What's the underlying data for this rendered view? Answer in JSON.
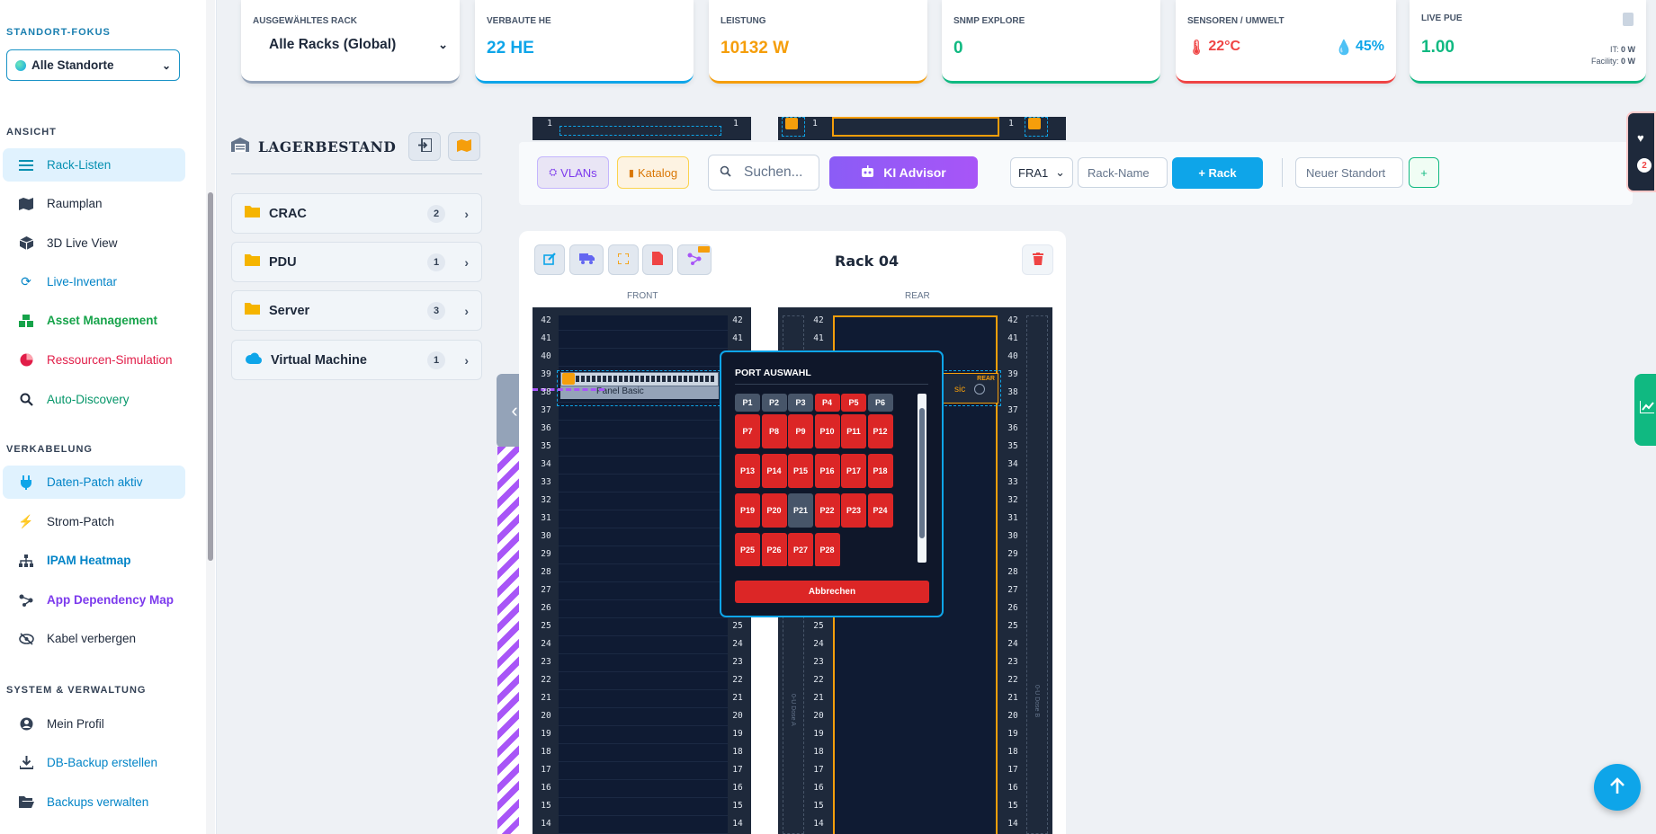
{
  "sidebar": {
    "site_section": "STANDORT-FOKUS",
    "site_select": "Alle Standorte",
    "section_view": "ANSICHT",
    "view_items": [
      {
        "label": "Rack-Listen",
        "color": "#0891b2"
      },
      {
        "label": "Raumplan",
        "color": "#1e293b"
      },
      {
        "label": "3D Live View",
        "color": "#1e293b"
      },
      {
        "label": "Live-Inventar",
        "color": "#0284c7"
      },
      {
        "label": "Asset Management",
        "color": "#16a34a"
      },
      {
        "label": "Ressourcen-Simulation",
        "color": "#e11d48"
      },
      {
        "label": "Auto-Discovery",
        "color": "#059669"
      }
    ],
    "section_cabling": "VERKABELUNG",
    "cabling_items": [
      {
        "label": "Daten-Patch aktiv",
        "color": "#0284c7"
      },
      {
        "label": "Strom-Patch",
        "color": "#1e293b"
      },
      {
        "label": "IPAM Heatmap",
        "color": "#0284c7"
      },
      {
        "label": "App Dependency Map",
        "color": "#7c3aed"
      },
      {
        "label": "Kabel verbergen",
        "color": "#1e293b"
      }
    ],
    "section_system": "SYSTEM & VERWALTUNG",
    "system_items": [
      {
        "label": "Mein Profil",
        "color": "#1e293b"
      },
      {
        "label": "DB-Backup erstellen",
        "color": "#0284c7"
      },
      {
        "label": "Backups verwalten",
        "color": "#0284c7"
      }
    ]
  },
  "stats": {
    "rack_label": "AUSGEWÄHLTES RACK",
    "rack_value": "Alle Racks (Global)",
    "he_label": "VERBAUTE HE",
    "he_value": "22 HE",
    "power_label": "LEISTUNG",
    "power_value": "10132 W",
    "snmp_label": "SNMP EXPLORE",
    "snmp_value": "0",
    "sensor_label": "SENSOREN / UMWELT",
    "temp_value": "22°C",
    "humidity_value": "45%",
    "pue_label": "LIVE PUE",
    "pue_value": "1.00",
    "it_label": "IT:",
    "it_value": "0 W",
    "facility_label": "Facility:",
    "facility_value": "0 W",
    "colors": {
      "he": "#0ea5e9",
      "power": "#f59e0b",
      "snmp": "#10b981",
      "sensor": "#ef4444",
      "pue": "#10b981"
    }
  },
  "inventory": {
    "title": "LAGERBESTAND",
    "items": [
      {
        "label": "CRAC",
        "count": "2"
      },
      {
        "label": "PDU",
        "count": "1"
      },
      {
        "label": "Server",
        "count": "3"
      },
      {
        "label": "Virtual Machine",
        "count": "1"
      }
    ]
  },
  "toolbar": {
    "vlans": "VLANs",
    "catalog": "Katalog",
    "search_placeholder": "Suchen...",
    "ai_advisor": "KI Advisor",
    "site_code": "FRA1",
    "rack_name_placeholder": "Rack-Name",
    "add_rack": "+ Rack",
    "new_site_placeholder": "Neuer Standort",
    "add_site": "+"
  },
  "rack": {
    "title": "Rack 04",
    "front_label": "FRONT",
    "rear_label": "REAR",
    "device_name": "Panel Basic",
    "device_name_rear": "sic",
    "rear_tag": "REAR",
    "pdu_a": "0-U Dose A",
    "pdu_b": "0-U Dose B",
    "top_unit": "1",
    "units": [
      "42",
      "41",
      "40",
      "39",
      "38",
      "37",
      "36",
      "35",
      "34",
      "33",
      "32",
      "31",
      "30",
      "29",
      "28",
      "27",
      "26",
      "25",
      "24",
      "23",
      "22",
      "21",
      "20",
      "19",
      "18",
      "17",
      "16",
      "15",
      "14"
    ]
  },
  "port_popup": {
    "title": "PORT AUSWAHL",
    "cancel": "Abbrechen",
    "ports": [
      {
        "label": "P1",
        "state": "free"
      },
      {
        "label": "P2",
        "state": "free"
      },
      {
        "label": "P3",
        "state": "free"
      },
      {
        "label": "P4",
        "state": "used"
      },
      {
        "label": "P5",
        "state": "used"
      },
      {
        "label": "P6",
        "state": "free"
      },
      {
        "label": "P7",
        "state": "used"
      },
      {
        "label": "P8",
        "state": "used"
      },
      {
        "label": "P9",
        "state": "used"
      },
      {
        "label": "P10",
        "state": "used"
      },
      {
        "label": "P11",
        "state": "used"
      },
      {
        "label": "P12",
        "state": "used"
      },
      {
        "label": "P13",
        "state": "used"
      },
      {
        "label": "P14",
        "state": "used"
      },
      {
        "label": "P15",
        "state": "used"
      },
      {
        "label": "P16",
        "state": "used"
      },
      {
        "label": "P17",
        "state": "used"
      },
      {
        "label": "P18",
        "state": "used"
      },
      {
        "label": "P19",
        "state": "used"
      },
      {
        "label": "P20",
        "state": "used"
      },
      {
        "label": "P21",
        "state": "free"
      },
      {
        "label": "P22",
        "state": "used"
      },
      {
        "label": "P23",
        "state": "used"
      },
      {
        "label": "P24",
        "state": "used"
      },
      {
        "label": "P25",
        "state": "used"
      },
      {
        "label": "P26",
        "state": "used"
      },
      {
        "label": "P27",
        "state": "used"
      },
      {
        "label": "P28",
        "state": "used"
      }
    ]
  },
  "health_badge": "2"
}
